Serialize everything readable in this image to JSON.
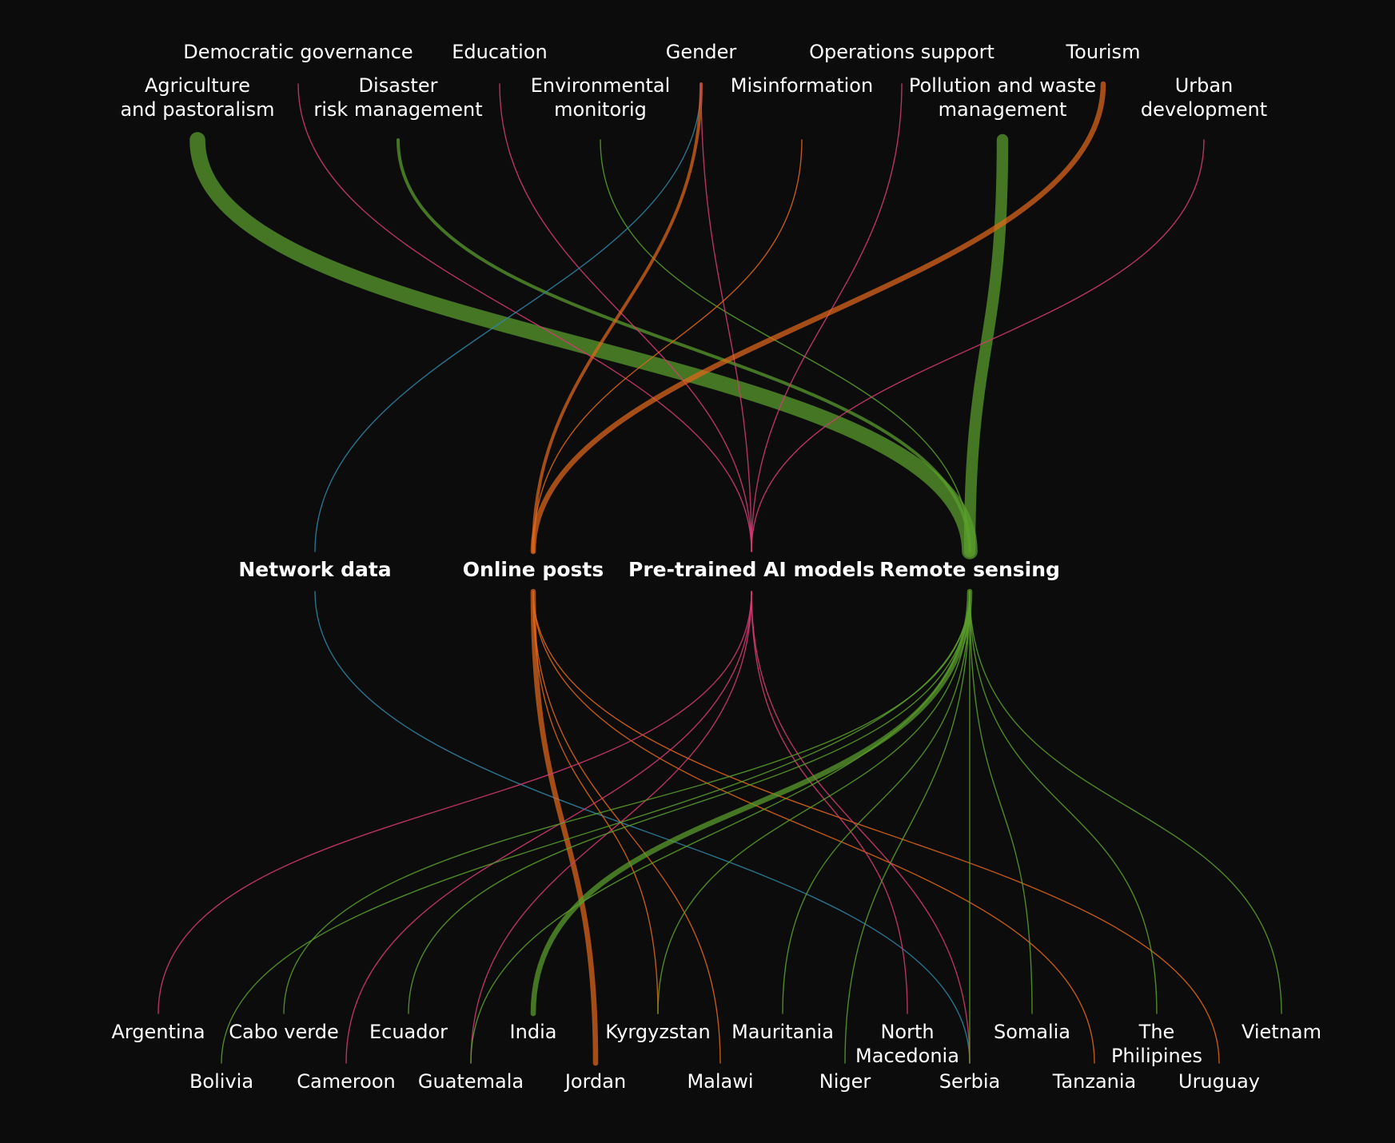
{
  "colors": {
    "background": "#0c0c0c",
    "Network data": "#2f86a6",
    "Online posts": "#e0671a",
    "Pre-trained AI models": "#d63b73",
    "Remote sensing": "#5aa02c",
    "label": "#ffffff"
  },
  "topics": [
    {
      "id": "agri",
      "lines": [
        "Agriculture",
        "and pastoralism"
      ]
    },
    {
      "id": "demgov",
      "lines": [
        "Democratic governance"
      ]
    },
    {
      "id": "drm",
      "lines": [
        "Disaster",
        "risk management"
      ]
    },
    {
      "id": "edu",
      "lines": [
        "Education"
      ]
    },
    {
      "id": "env",
      "lines": [
        "Environmental",
        "monitorig"
      ]
    },
    {
      "id": "gender",
      "lines": [
        "Gender"
      ]
    },
    {
      "id": "misinfo",
      "lines": [
        "Misinformation"
      ]
    },
    {
      "id": "ops",
      "lines": [
        "Operations support"
      ]
    },
    {
      "id": "pollution",
      "lines": [
        "Pollution and waste",
        "management"
      ]
    },
    {
      "id": "tourism",
      "lines": [
        "Tourism"
      ]
    },
    {
      "id": "urban",
      "lines": [
        "Urban",
        "development"
      ]
    }
  ],
  "sources": [
    {
      "id": "network",
      "label": "Network data"
    },
    {
      "id": "online",
      "label": "Online posts"
    },
    {
      "id": "ai",
      "label": "Pre-trained AI models"
    },
    {
      "id": "remote",
      "label": "Remote sensing"
    }
  ],
  "countries": [
    {
      "id": "argentina",
      "lines": [
        "Argentina"
      ]
    },
    {
      "id": "bolivia",
      "lines": [
        "Bolivia"
      ]
    },
    {
      "id": "caboverde",
      "lines": [
        "Cabo verde"
      ]
    },
    {
      "id": "cameroon",
      "lines": [
        "Cameroon"
      ]
    },
    {
      "id": "ecuador",
      "lines": [
        "Ecuador"
      ]
    },
    {
      "id": "guatemala",
      "lines": [
        "Guatemala"
      ]
    },
    {
      "id": "india",
      "lines": [
        "India"
      ]
    },
    {
      "id": "jordan",
      "lines": [
        "Jordan"
      ]
    },
    {
      "id": "kyrgyzstan",
      "lines": [
        "Kyrgyzstan"
      ]
    },
    {
      "id": "malawi",
      "lines": [
        "Malawi"
      ]
    },
    {
      "id": "mauritania",
      "lines": [
        "Mauritania"
      ]
    },
    {
      "id": "niger",
      "lines": [
        "Niger"
      ]
    },
    {
      "id": "northmacedonia",
      "lines": [
        "North",
        "Macedonia"
      ]
    },
    {
      "id": "serbia",
      "lines": [
        "Serbia"
      ]
    },
    {
      "id": "somalia",
      "lines": [
        "Somalia"
      ]
    },
    {
      "id": "tanzania",
      "lines": [
        "Tanzania"
      ]
    },
    {
      "id": "philippines",
      "lines": [
        "The",
        "Philipines"
      ]
    },
    {
      "id": "uruguay",
      "lines": [
        "Uruguay"
      ]
    },
    {
      "id": "vietnam",
      "lines": [
        "Vietnam"
      ]
    }
  ],
  "topic_links": [
    {
      "topic": "agri",
      "source": "remote",
      "weight": 8
    },
    {
      "topic": "demgov",
      "source": "ai",
      "weight": 1
    },
    {
      "topic": "drm",
      "source": "remote",
      "weight": 2
    },
    {
      "topic": "edu",
      "source": "ai",
      "weight": 1
    },
    {
      "topic": "env",
      "source": "remote",
      "weight": 1
    },
    {
      "topic": "gender",
      "source": "network",
      "weight": 1
    },
    {
      "topic": "gender",
      "source": "online",
      "weight": 2
    },
    {
      "topic": "gender",
      "source": "ai",
      "weight": 1
    },
    {
      "topic": "misinfo",
      "source": "online",
      "weight": 1
    },
    {
      "topic": "ops",
      "source": "ai",
      "weight": 1
    },
    {
      "topic": "pollution",
      "source": "remote",
      "weight": 6
    },
    {
      "topic": "tourism",
      "source": "online",
      "weight": 3
    },
    {
      "topic": "urban",
      "source": "ai",
      "weight": 1
    }
  ],
  "country_links": [
    {
      "source": "network",
      "country": "serbia",
      "weight": 1
    },
    {
      "source": "online",
      "country": "jordan",
      "weight": 3
    },
    {
      "source": "online",
      "country": "kyrgyzstan",
      "weight": 1
    },
    {
      "source": "online",
      "country": "malawi",
      "weight": 1
    },
    {
      "source": "online",
      "country": "tanzania",
      "weight": 1
    },
    {
      "source": "online",
      "country": "uruguay",
      "weight": 1
    },
    {
      "source": "ai",
      "country": "argentina",
      "weight": 1
    },
    {
      "source": "ai",
      "country": "cameroon",
      "weight": 1
    },
    {
      "source": "ai",
      "country": "guatemala",
      "weight": 1
    },
    {
      "source": "ai",
      "country": "northmacedonia",
      "weight": 1
    },
    {
      "source": "ai",
      "country": "serbia",
      "weight": 1
    },
    {
      "source": "remote",
      "country": "bolivia",
      "weight": 1
    },
    {
      "source": "remote",
      "country": "caboverde",
      "weight": 1
    },
    {
      "source": "remote",
      "country": "ecuador",
      "weight": 1
    },
    {
      "source": "remote",
      "country": "guatemala",
      "weight": 1
    },
    {
      "source": "remote",
      "country": "india",
      "weight": 3
    },
    {
      "source": "remote",
      "country": "kyrgyzstan",
      "weight": 1
    },
    {
      "source": "remote",
      "country": "mauritania",
      "weight": 1
    },
    {
      "source": "remote",
      "country": "niger",
      "weight": 1
    },
    {
      "source": "remote",
      "country": "serbia",
      "weight": 1
    },
    {
      "source": "remote",
      "country": "somalia",
      "weight": 1
    },
    {
      "source": "remote",
      "country": "philippines",
      "weight": 1
    },
    {
      "source": "remote",
      "country": "vietnam",
      "weight": 1
    }
  ]
}
